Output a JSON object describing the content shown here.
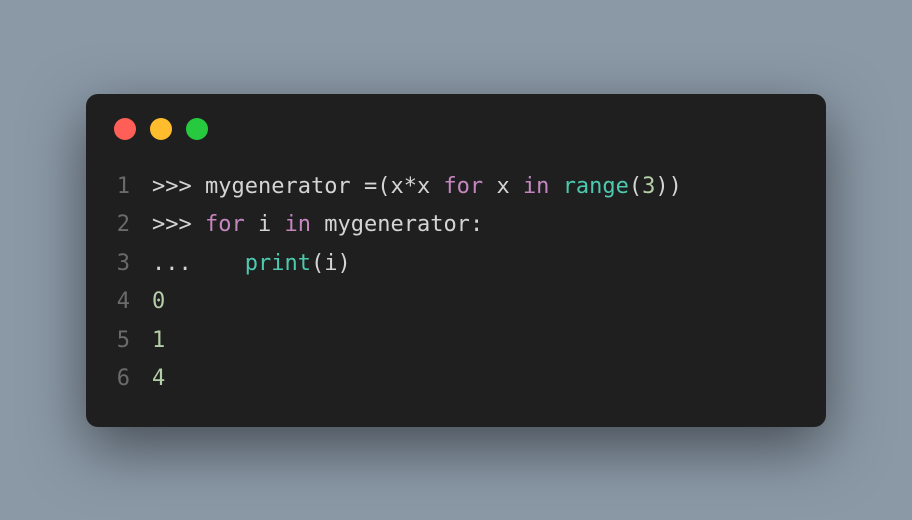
{
  "colors": {
    "red": "#ff5f56",
    "yellow": "#ffbd2e",
    "green": "#27c93f"
  },
  "code": {
    "lines": [
      {
        "num": "1"
      },
      {
        "num": "2"
      },
      {
        "num": "3"
      },
      {
        "num": "4"
      },
      {
        "num": "5"
      },
      {
        "num": "6"
      }
    ],
    "l1": {
      "prompt": ">>> ",
      "ident1": "mygenerator ",
      "eq": "=",
      "lp1": "(",
      "expr": "x",
      "star": "*",
      "expr2": "x ",
      "for": "for",
      "sp1": " ",
      "x": "x ",
      "in": "in",
      "sp2": " ",
      "range": "range",
      "lp2": "(",
      "three": "3",
      "rp2": ")",
      "rp1": ")"
    },
    "l2": {
      "prompt": ">>> ",
      "for": "for",
      "sp1": " ",
      "i": "i ",
      "in": "in",
      "sp2": " ",
      "gen": "mygenerator",
      "colon": ":"
    },
    "l3": {
      "cont": "...    ",
      "print": "print",
      "lp": "(",
      "i": "i",
      "rp": ")"
    },
    "l4": {
      "val": "0"
    },
    "l5": {
      "val": "1"
    },
    "l6": {
      "val": "4"
    }
  }
}
